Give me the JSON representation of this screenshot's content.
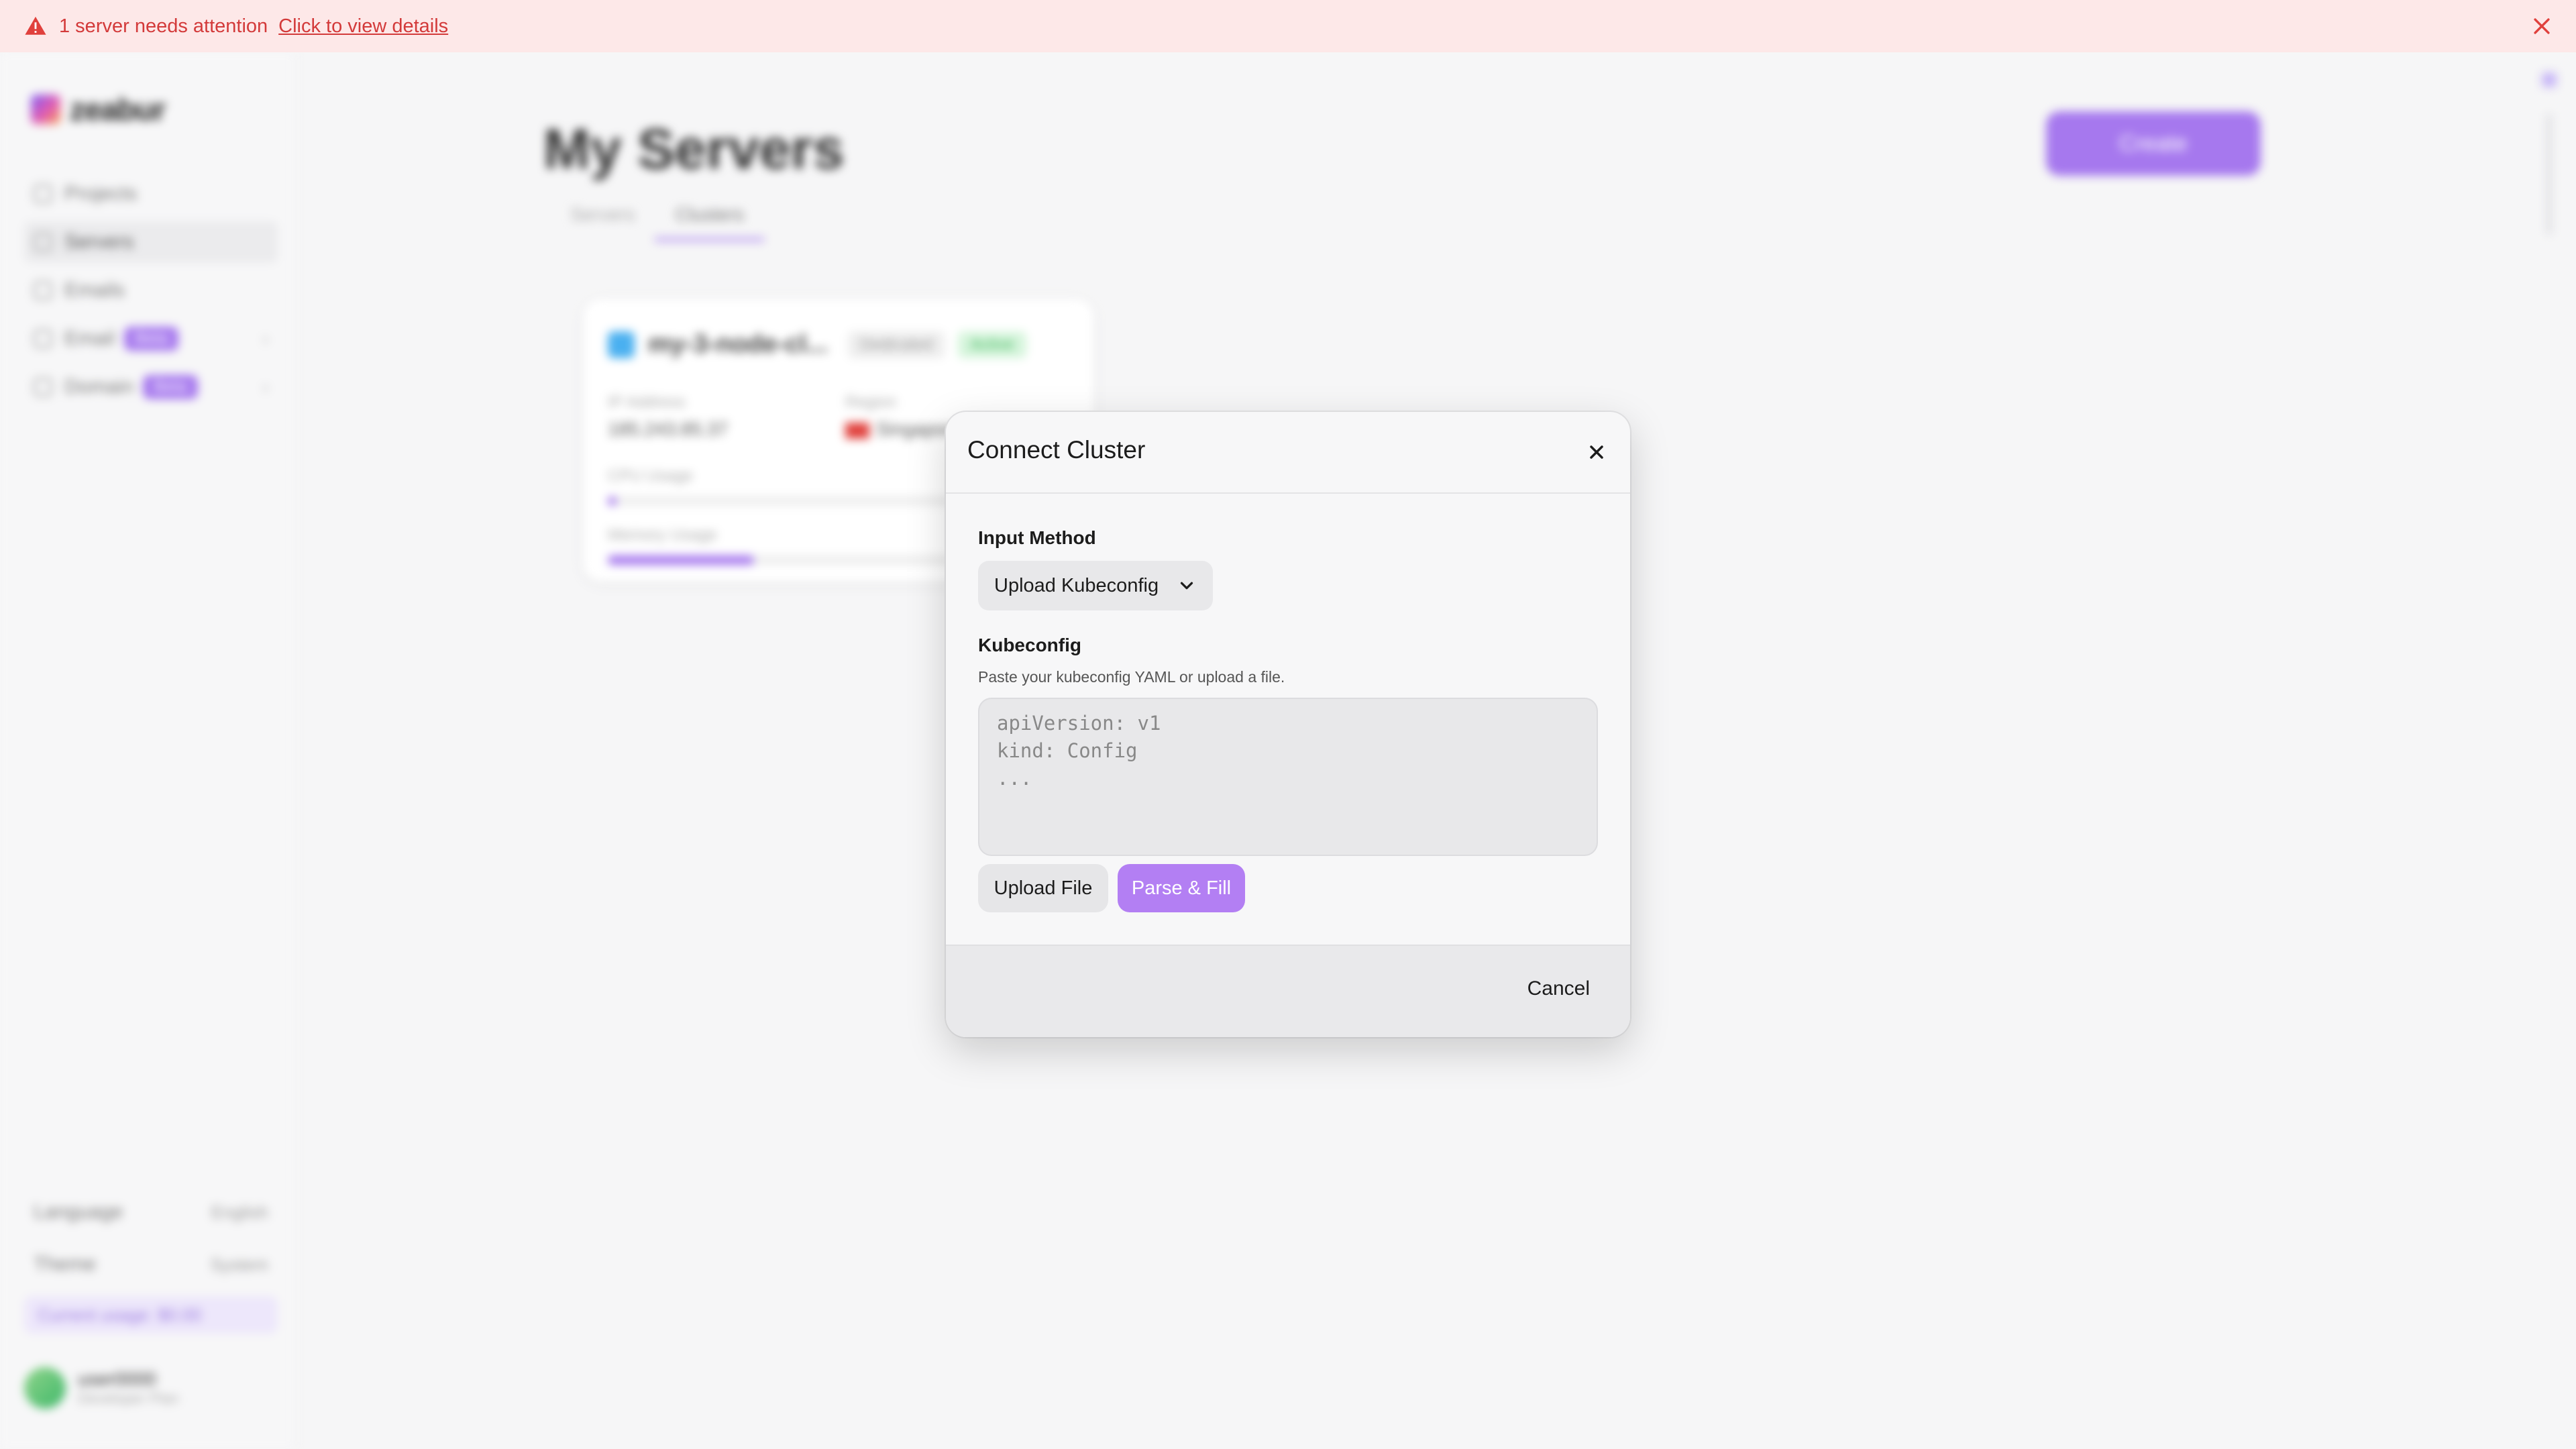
{
  "banner": {
    "message": "1 server needs attention",
    "link": "Click to view details",
    "color": "#d33a3a",
    "background": "#fde8e8"
  },
  "background_app": {
    "logo": "zeabur",
    "nav": [
      {
        "label": "Projects"
      },
      {
        "label": "Servers",
        "active": true
      },
      {
        "label": "Emails"
      },
      {
        "label": "Email",
        "badge": "Beta"
      },
      {
        "label": "Domain",
        "badge": "Beta"
      }
    ],
    "bottom": {
      "language_label": "Language",
      "language_value": "English",
      "theme_label": "Theme",
      "theme_value": "System",
      "usage": "Current usage: $0.00",
      "user_name": "user0000",
      "user_plan": "Developer Plan"
    },
    "page_title": "My Servers",
    "create_button": "Create",
    "tabs": [
      {
        "label": "Servers"
      },
      {
        "label": "Clusters",
        "active": true
      }
    ],
    "server_card": {
      "name": "my-3-node-cl...",
      "tag": "Dedicated",
      "status": "Active",
      "ip_label": "IP Address",
      "ip_value": "185.243.85.37",
      "region_label": "Region",
      "region_value": "Singapore",
      "cpu_label": "CPU Usage",
      "cpu_value": 2,
      "memory_label": "Memory Usage",
      "memory_value": 33
    }
  },
  "modal": {
    "title": "Connect Cluster",
    "input_method_label": "Input Method",
    "input_method_value": "Upload Kubeconfig",
    "kubeconfig_label": "Kubeconfig",
    "kubeconfig_hint": "Paste your kubeconfig YAML or upload a file.",
    "kubeconfig_placeholder": "apiVersion: v1\nkind: Config\n...",
    "kubeconfig_value": "",
    "upload_button": "Upload File",
    "parse_button": "Parse & Fill",
    "cancel_button": "Cancel",
    "accent_color": "#b37ff3"
  },
  "icons": {
    "banner_warning": "warning-triangle-icon",
    "banner_close": "close-icon",
    "modal_close": "close-icon",
    "select_chevron": "chevron-down-icon"
  }
}
